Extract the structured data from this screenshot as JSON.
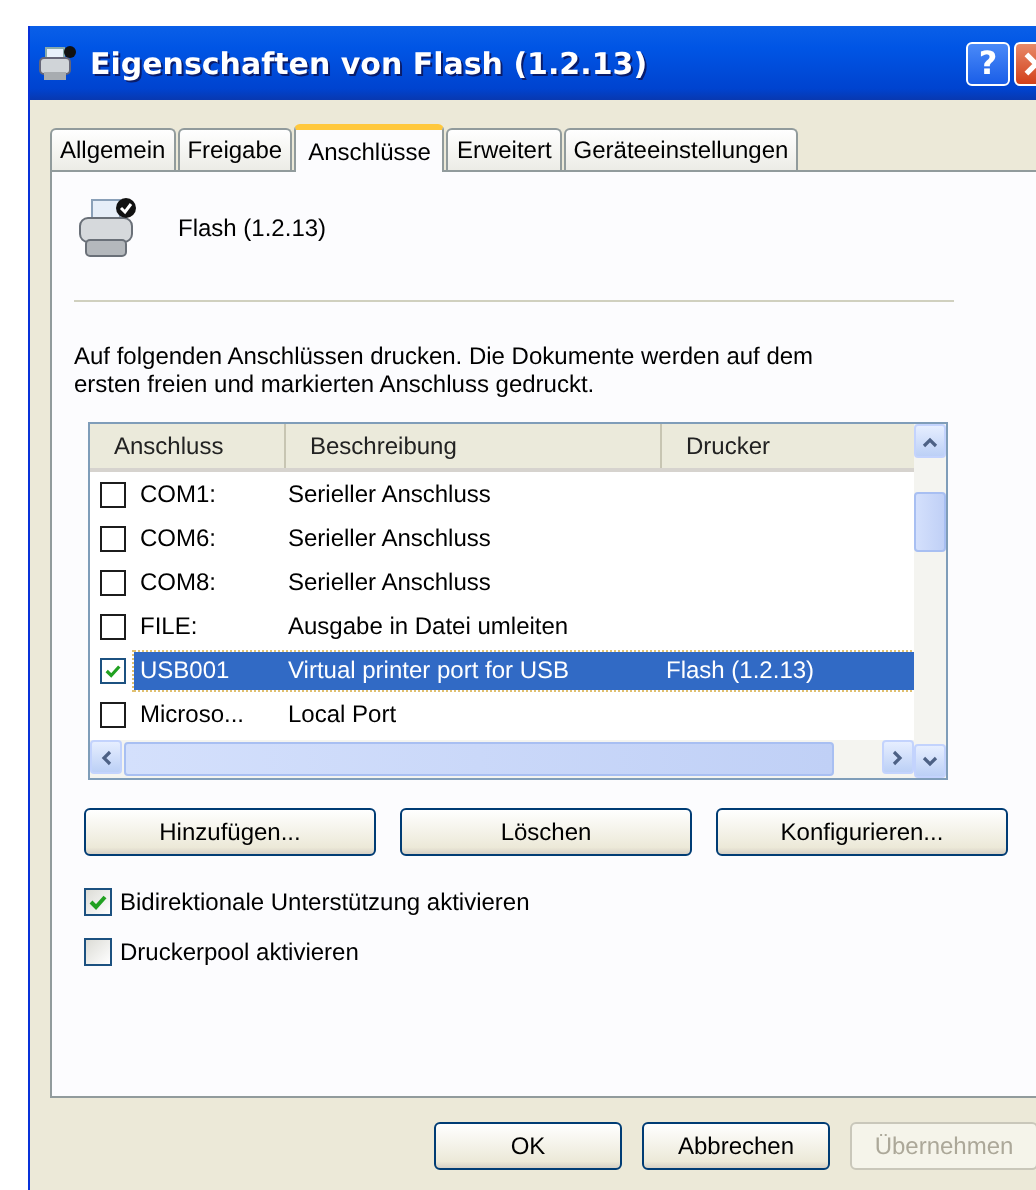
{
  "window": {
    "title": "Eigenschaften von Flash (1.2.13)",
    "help_button": "?"
  },
  "tabs": [
    {
      "label": "Allgemein",
      "selected": false
    },
    {
      "label": "Freigabe",
      "selected": false
    },
    {
      "label": "Anschlüsse",
      "selected": true
    },
    {
      "label": "Erweitert",
      "selected": false
    },
    {
      "label": "Geräteeinstellungen",
      "selected": false
    }
  ],
  "printer_name": "Flash (1.2.13)",
  "description": "Auf folgenden Anschlüssen drucken. Die Dokumente werden auf dem ersten freien und markierten Anschluss gedruckt.",
  "table": {
    "columns": [
      "Anschluss",
      "Beschreibung",
      "Drucker"
    ],
    "rows": [
      {
        "checked": false,
        "selected": false,
        "cells": [
          "COM1:",
          "Serieller Anschluss",
          ""
        ]
      },
      {
        "checked": false,
        "selected": false,
        "cells": [
          "COM6:",
          "Serieller Anschluss",
          ""
        ]
      },
      {
        "checked": false,
        "selected": false,
        "cells": [
          "COM8:",
          "Serieller Anschluss",
          ""
        ]
      },
      {
        "checked": false,
        "selected": false,
        "cells": [
          "FILE:",
          "Ausgabe in Datei umleiten",
          ""
        ]
      },
      {
        "checked": true,
        "selected": true,
        "cells": [
          "USB001",
          "Virtual printer port for USB",
          "Flash (1.2.13)"
        ]
      },
      {
        "checked": false,
        "selected": false,
        "cells": [
          "Microso...",
          "Local Port",
          ""
        ]
      }
    ]
  },
  "port_buttons": [
    {
      "label": "Hinzufügen..."
    },
    {
      "label": "Löschen"
    },
    {
      "label": "Konfigurieren..."
    }
  ],
  "options": [
    {
      "label": "Bidirektionale Unterstützung aktivieren",
      "checked": true
    },
    {
      "label": "Druckerpool aktivieren",
      "checked": false
    }
  ],
  "buttons": [
    {
      "label": "OK",
      "disabled": false
    },
    {
      "label": "Abbrechen",
      "disabled": false
    },
    {
      "label": "Übernehmen",
      "disabled": true
    }
  ]
}
